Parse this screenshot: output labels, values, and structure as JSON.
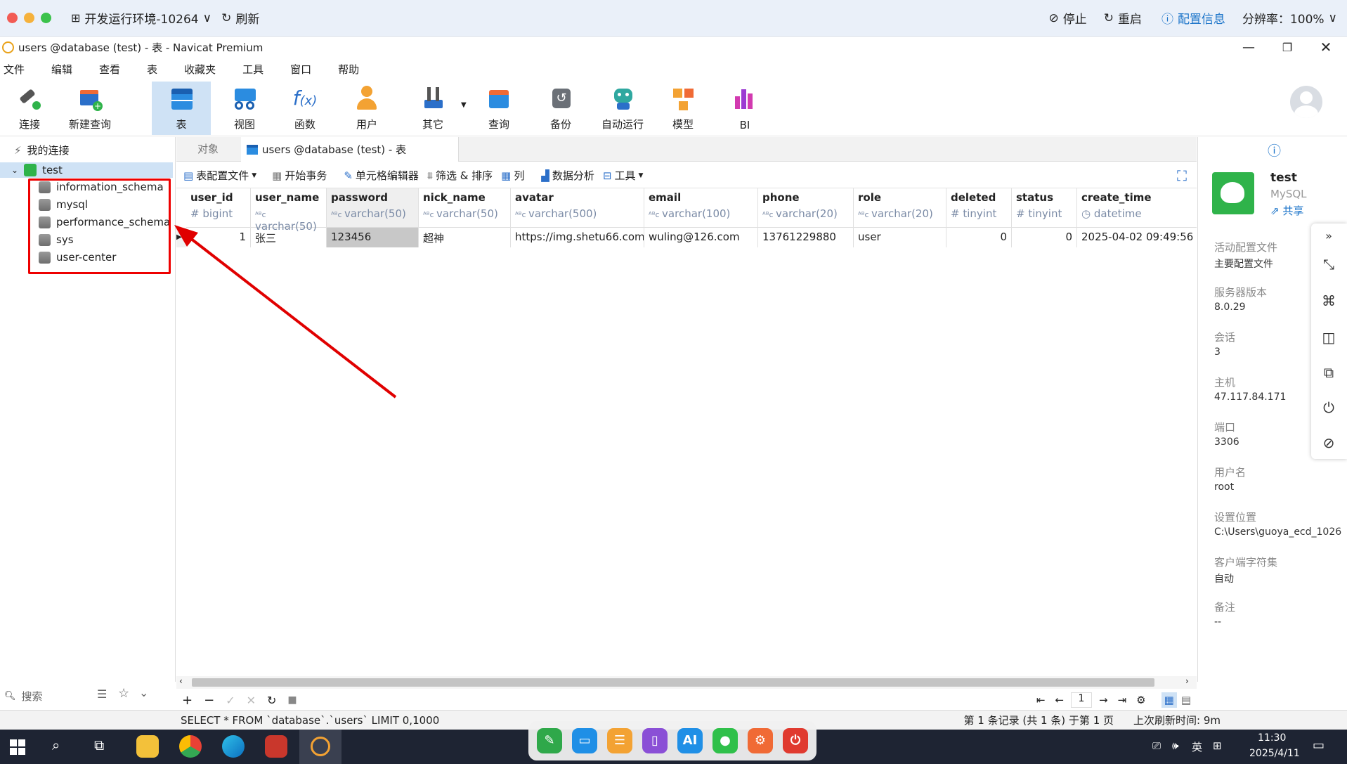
{
  "remote": {
    "env_label": "开发运行环境-10264",
    "refresh": "刷新",
    "stop": "停止",
    "restart": "重启",
    "config": "配置信息",
    "resolution": "分辨率：100%"
  },
  "window": {
    "title": "users @database (test) - 表 - Navicat Premium"
  },
  "menu": [
    "文件",
    "编辑",
    "查看",
    "表",
    "收藏夹",
    "工具",
    "窗口",
    "帮助"
  ],
  "toolbar": [
    {
      "label": "连接"
    },
    {
      "label": "新建查询"
    },
    {
      "label": "表"
    },
    {
      "label": "视图"
    },
    {
      "label": "函数"
    },
    {
      "label": "用户"
    },
    {
      "label": "其它"
    },
    {
      "label": "查询"
    },
    {
      "label": "备份"
    },
    {
      "label": "自动运行"
    },
    {
      "label": "模型"
    },
    {
      "label": "BI"
    }
  ],
  "tree": {
    "root": "我的连接",
    "connection": "test",
    "databases": [
      "information_schema",
      "mysql",
      "performance_schema",
      "sys",
      "user-center"
    ],
    "search_placeholder": "搜索"
  },
  "tabs": {
    "objects": "对象",
    "active": "users @database (test) - 表"
  },
  "subtoolbar": {
    "profile": "表配置文件",
    "begin_tx": "开始事务",
    "cell_editor": "单元格编辑器",
    "filter_sort": "筛选 & 排序",
    "columns": "列",
    "analysis": "数据分析",
    "tools": "工具"
  },
  "grid": {
    "columns": [
      {
        "name": "user_id",
        "type": "bigint",
        "kind": "#"
      },
      {
        "name": "user_name",
        "type": "varchar(50)",
        "kind": "abc"
      },
      {
        "name": "password",
        "type": "varchar(50)",
        "kind": "abc"
      },
      {
        "name": "nick_name",
        "type": "varchar(50)",
        "kind": "abc"
      },
      {
        "name": "avatar",
        "type": "varchar(500)",
        "kind": "abc"
      },
      {
        "name": "email",
        "type": "varchar(100)",
        "kind": "abc"
      },
      {
        "name": "phone",
        "type": "varchar(20)",
        "kind": "abc"
      },
      {
        "name": "role",
        "type": "varchar(20)",
        "kind": "abc"
      },
      {
        "name": "deleted",
        "type": "tinyint",
        "kind": "#"
      },
      {
        "name": "status",
        "type": "tinyint",
        "kind": "#"
      },
      {
        "name": "create_time",
        "type": "datetime",
        "kind": "clock"
      }
    ],
    "rows": [
      [
        "1",
        "张三",
        "123456",
        "超神",
        "https://img.shetu66.com",
        "wuling@126.com",
        "13761229880",
        "user",
        "0",
        "0",
        "2025-04-02 09:49:56"
      ]
    ],
    "page": "1"
  },
  "info": {
    "name": "test",
    "type": "MySQL",
    "share": "共享",
    "fields": [
      {
        "label": "活动配置文件",
        "value": "主要配置文件"
      },
      {
        "label": "服务器版本",
        "value": "8.0.29"
      },
      {
        "label": "会话",
        "value": "3"
      },
      {
        "label": "主机",
        "value": "47.117.84.171"
      },
      {
        "label": "端口",
        "value": "3306"
      },
      {
        "label": "用户名",
        "value": "root"
      },
      {
        "label": "设置位置",
        "value": "C:\\Users\\guoya_ecd_1026"
      },
      {
        "label": "客户端字符集",
        "value": "自动"
      },
      {
        "label": "备注",
        "value": "--"
      }
    ]
  },
  "status": {
    "sql": "SELECT * FROM `database`.`users` LIMIT 0,1000",
    "records": "第 1 条记录 (共 1 条) 于第 1 页",
    "refresh": "上次刷新时间: 9m"
  },
  "taskbar": {
    "time": "11:30",
    "date": "2025/4/11",
    "ime": "英"
  },
  "colors": {
    "accent": "#1a73c9",
    "annotation": "#e00000",
    "navicat_green": "#2fb34a"
  }
}
